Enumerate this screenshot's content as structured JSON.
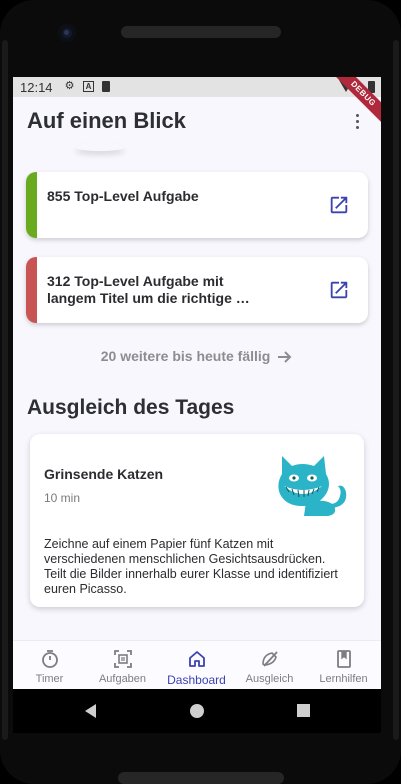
{
  "status_bar": {
    "time": "12:14",
    "debug_banner": "DEBUG"
  },
  "header": {
    "title": "Auf einen Blick",
    "menu_icon": "more-vert-icon"
  },
  "tasks": [
    {
      "title": "855 Top-Level Aufgabe",
      "color": "#6aaa1f",
      "icon": "open-in-new-icon"
    },
    {
      "title": "312 Top-Level Aufgabe mit langem Titel um die richtige …",
      "color": "#c85454",
      "icon": "open-in-new-icon"
    }
  ],
  "more_link": {
    "label": "20 weitere bis heute fällig",
    "icon": "arrow-right-icon"
  },
  "balance_section": {
    "title": "Ausgleich des Tages",
    "card": {
      "title": "Grinsende Katzen",
      "duration": "10 min",
      "description": "Zeichne auf einem Papier fünf Katzen mit verschiedenen menschlichen Gesichtsausdrücken.\n Teilt die Bilder innerhalb eurer Klasse und identifiziert euren Picasso.",
      "image": "grinning-cat-icon",
      "image_color": "#2bb3c8"
    }
  },
  "bottom_nav": {
    "items": [
      {
        "label": "Timer",
        "icon": "timer-icon"
      },
      {
        "label": "Aufgaben",
        "icon": "task-frame-icon"
      },
      {
        "label": "Dashboard",
        "icon": "home-icon",
        "active": true
      },
      {
        "label": "Ausgleich",
        "icon": "balance-icon"
      },
      {
        "label": "Lernhilfen",
        "icon": "bookmark-book-icon"
      }
    ],
    "active_color": "#3a43b0"
  }
}
